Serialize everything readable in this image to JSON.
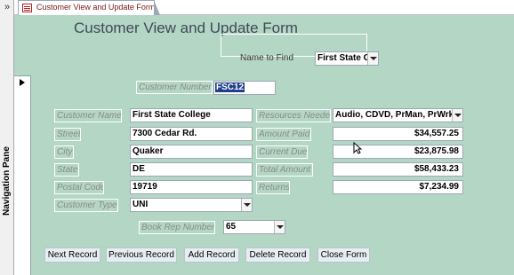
{
  "navigation_pane": {
    "label": "Navigation Pane",
    "expand_glyph": "»"
  },
  "tab": {
    "title": "Customer View and Update Form"
  },
  "form": {
    "title": "Customer View and Update Form",
    "name_to_find": {
      "label": "Name to Find",
      "value": "First State Co"
    },
    "customer_number": {
      "label": "Customer Number",
      "value": "FSC12"
    },
    "left_fields": [
      {
        "label": "Customer Name",
        "value": "First State College"
      },
      {
        "label": "Street",
        "value": "7300 Cedar Rd."
      },
      {
        "label": "City",
        "value": "Quaker"
      },
      {
        "label": "State",
        "value": "DE"
      },
      {
        "label": "Postal Code",
        "value": "19719"
      },
      {
        "label": "Customer Type",
        "value": "UNI"
      }
    ],
    "right_fields": [
      {
        "label": "Resources Needed",
        "value": "Audio, CDVD, PrMan, PrWrk"
      },
      {
        "label": "Amount Paid",
        "value": "$34,557.25"
      },
      {
        "label": "Current Due",
        "value": "$23,875.98"
      },
      {
        "label": "Total Amount",
        "value": "$58,433.23"
      },
      {
        "label": "Returns",
        "value": "$7,234.99"
      }
    ],
    "book_rep_number": {
      "label": "Book Rep Number",
      "value": "65"
    },
    "buttons": {
      "next": "Next Record",
      "previous": "Previous Record",
      "add": "Add Record",
      "delete": "Delete Record",
      "close": "Close Form"
    }
  },
  "colors": {
    "form_background": "#b4d6c5",
    "title_text": "#3f4a57",
    "label_text": "#8a8a8a",
    "selection": "#1f3f8a"
  },
  "icons": [
    "chevron-right-double-icon",
    "form-icon",
    "dropdown-arrow-icon",
    "record-selector-arrow-icon",
    "mouse-cursor-icon"
  ]
}
